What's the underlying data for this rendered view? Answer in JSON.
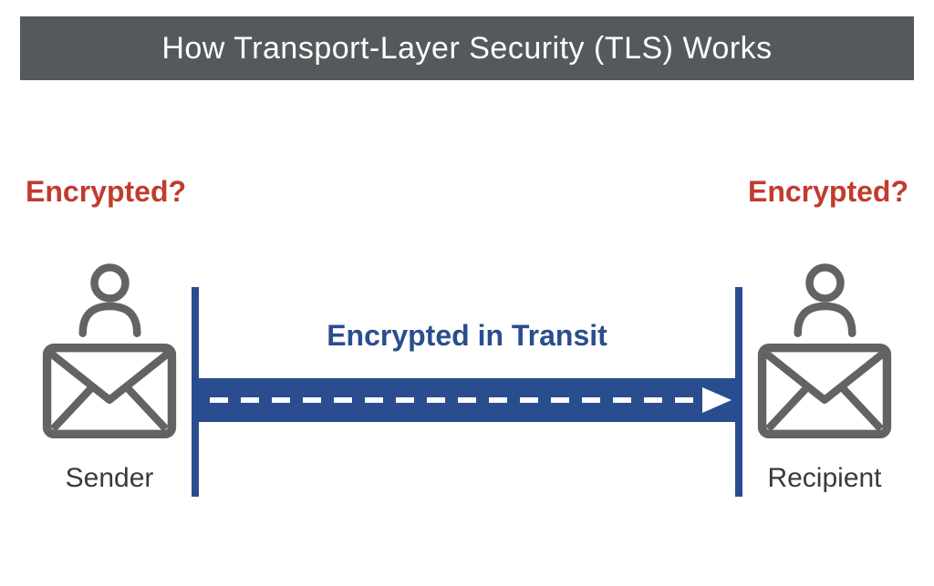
{
  "title": "How Transport-Layer Security (TLS) Works",
  "labels": {
    "encrypted_left": "Encrypted?",
    "encrypted_right": "Encrypted?",
    "transit": "Encrypted in Transit",
    "sender": "Sender",
    "recipient": "Recipient"
  },
  "colors": {
    "title_bg": "#56595b",
    "title_text": "#ffffff",
    "encrypted_text": "#c23b2e",
    "transit_text": "#2a4d8f",
    "transit_bar": "#2a4d8f",
    "icon_stroke": "#616365",
    "role_label": "#3a3a3a"
  }
}
